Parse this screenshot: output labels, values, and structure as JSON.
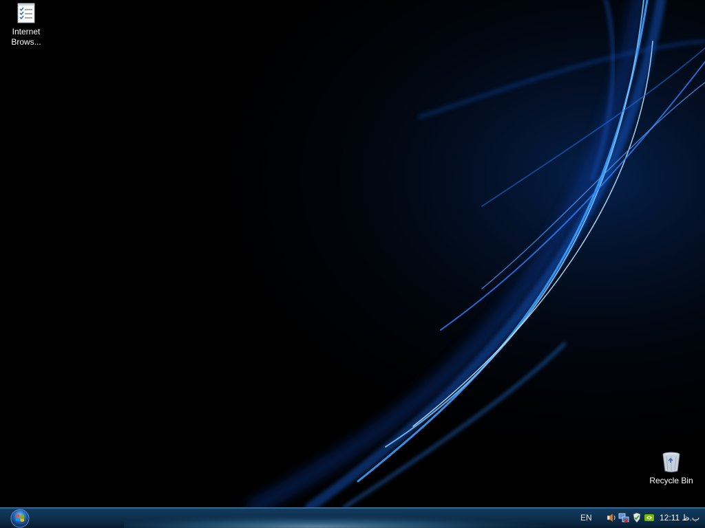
{
  "desktop": {
    "icons": [
      {
        "label": "Internet\nBrows...",
        "icon": "checklist-document-icon"
      },
      {
        "label": "Recycle Bin",
        "icon": "recycle-bin-icon"
      }
    ]
  },
  "taskbar": {
    "start_button": {
      "icon": "windows-start-orb-icon"
    },
    "language": "EN",
    "tray_icons": [
      "speaker-icon",
      "network-disconnected-icon",
      "security-shield-icon",
      "nvidia-icon"
    ],
    "clock": "12:11 ب.ظ"
  },
  "colors": {
    "taskbar_top": "#10395d",
    "taskbar_bottom": "#071d31",
    "wallpaper_accent": "#3aa0ff"
  }
}
